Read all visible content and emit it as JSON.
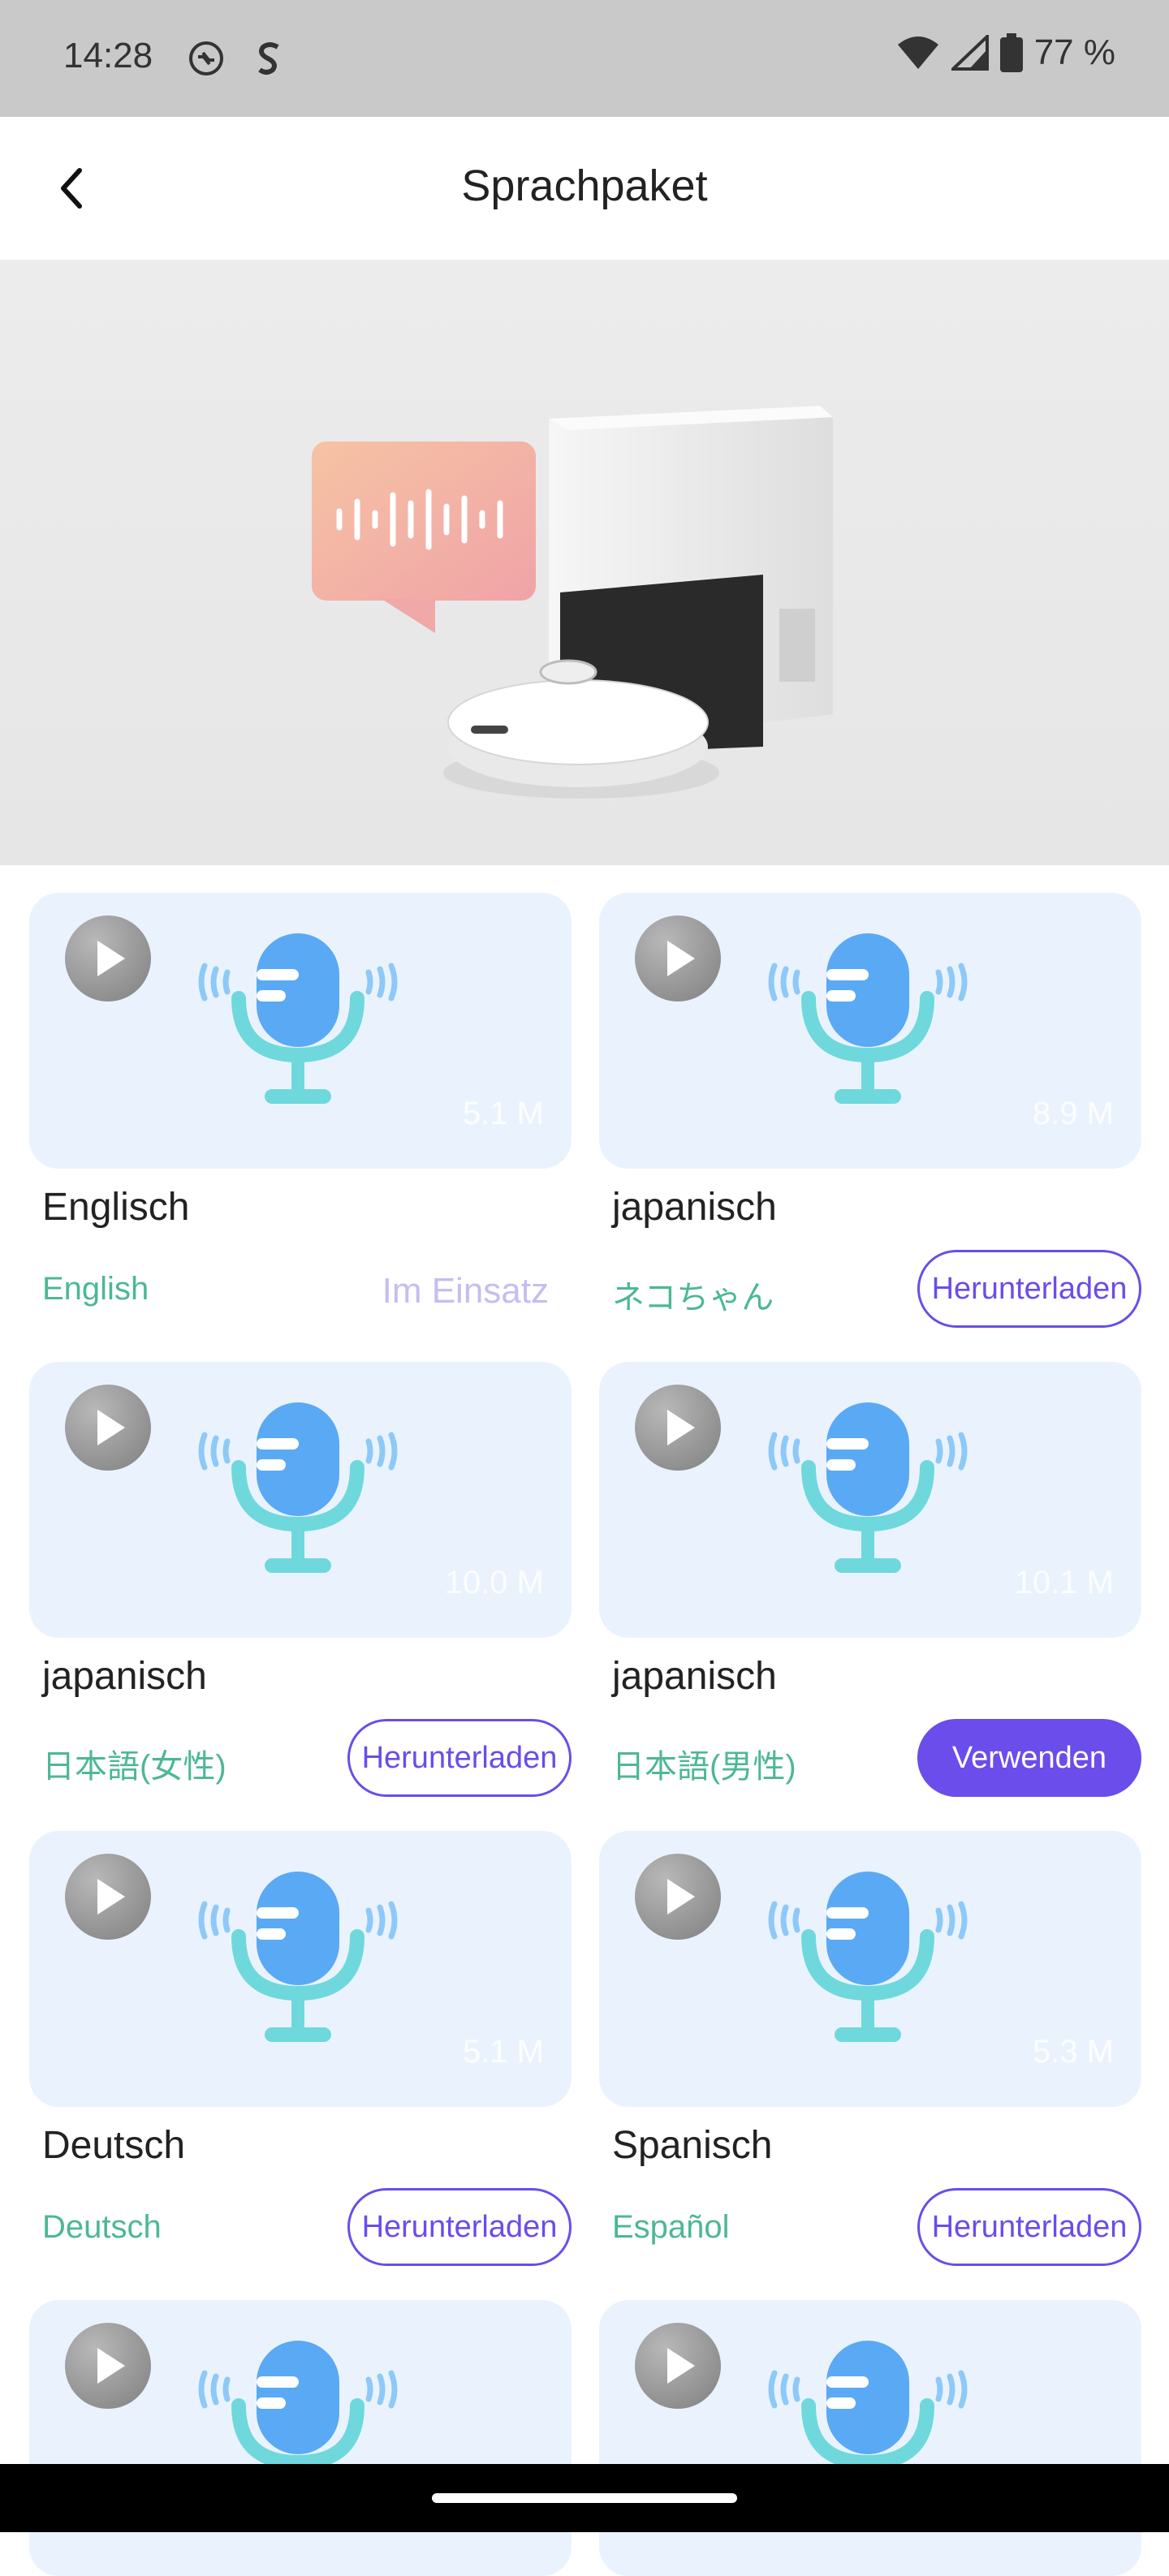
{
  "status_bar": {
    "time": "14:28",
    "icons_left": [
      "sync-icon",
      "s-app-icon"
    ],
    "icons_right": [
      "wifi-icon",
      "signal-icon",
      "battery-icon"
    ],
    "battery": "77 %"
  },
  "header": {
    "back_icon": "back-arrow-icon",
    "title": "Sprachpaket"
  },
  "banner": {
    "image": "robot-vacuum-with-dock-and-speech-bubble"
  },
  "voice_packs": [
    {
      "name": "Englisch",
      "subtitle": "English",
      "size": "5.1 M",
      "status": "Im Einsatz",
      "action": ""
    },
    {
      "name": "japanisch",
      "subtitle": "ネコちゃん",
      "size": "8.9 M",
      "status": "",
      "action": "Herunterladen"
    },
    {
      "name": "japanisch",
      "subtitle": "日本語(女性)",
      "size": "10.0 M",
      "status": "",
      "action": "Herunterladen"
    },
    {
      "name": "japanisch",
      "subtitle": "日本語(男性)",
      "size": "10.1 M",
      "status": "",
      "action": "Verwenden"
    },
    {
      "name": "Deutsch",
      "subtitle": "Deutsch",
      "size": "5.1 M",
      "status": "",
      "action": "Herunterladen"
    },
    {
      "name": "Spanisch",
      "subtitle": "Español",
      "size": "5.3 M",
      "status": "",
      "action": "Herunterladen"
    },
    {
      "name": "",
      "subtitle": "",
      "size": "",
      "status": "",
      "action": ""
    },
    {
      "name": "",
      "subtitle": "",
      "size": "",
      "status": "",
      "action": ""
    }
  ],
  "colors": {
    "accent": "#6a4dea",
    "subtitle_green": "#4db893",
    "in_use_text": "#c6bdf0",
    "card_bg": "#eaf3fd",
    "mic_blue": "#5aa9f5",
    "mic_cyan": "#6fd8dd"
  }
}
